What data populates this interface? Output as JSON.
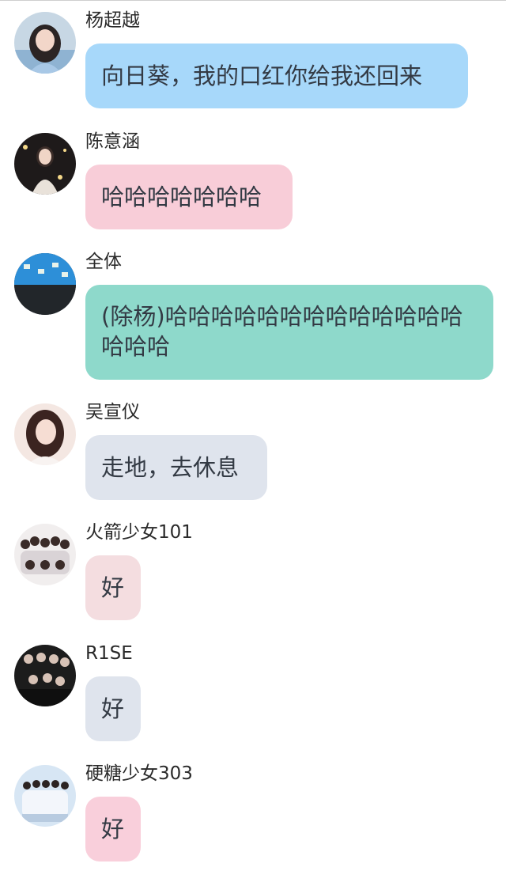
{
  "messages": [
    {
      "sender": "杨超越",
      "text": "向日葵，我的口红你给我还回来",
      "color": "#a7d8fa"
    },
    {
      "sender": "陈意涵",
      "text": "哈哈哈哈哈哈哈",
      "color": "#f8cdd8"
    },
    {
      "sender": "全体",
      "text": "(除杨)哈哈哈哈哈哈哈哈哈哈哈哈哈哈哈哈",
      "color": "#8ed9cb"
    },
    {
      "sender": "吴宣仪",
      "text": "走地，去休息",
      "color": "#dfe4ed"
    },
    {
      "sender": "火箭少女101",
      "text": "好",
      "color": "#f4dde0"
    },
    {
      "sender": "R1SE",
      "text": "好",
      "color": "#dfe4ed"
    },
    {
      "sender": "硬糖少女303",
      "text": "好",
      "color": "#f9cfdb"
    }
  ]
}
